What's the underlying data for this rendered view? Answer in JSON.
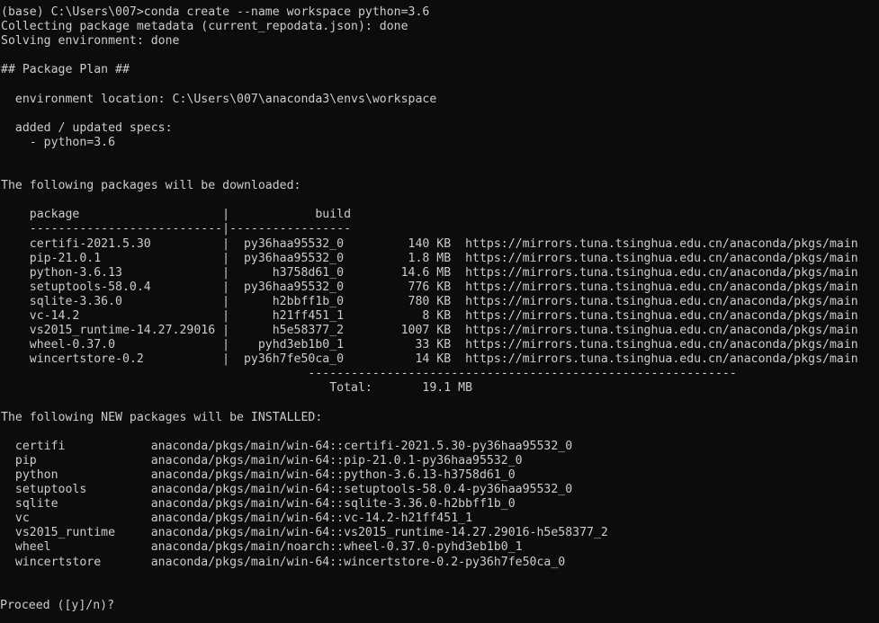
{
  "terminal": {
    "window_kind": "windows-command-prompt",
    "background_color": "#0c0c0c",
    "foreground_color": "#cccccc",
    "columns": 122,
    "rows": 43,
    "prompt_prefix": "(base) C:\\Users\\007>",
    "command": "conda create --name workspace python=3.6",
    "prompt_line": "(base) C:\\Users\\007>conda create --name workspace python=3.6"
  },
  "output": {
    "collecting_metadata": "Collecting package metadata (current_repodata.json): done",
    "solving_environment": "Solving environment: done",
    "package_plan_header": "## Package Plan ##",
    "environment_location_label": "environment location:",
    "environment_location_value": "C:\\Users\\007\\anaconda3\\envs\\workspace",
    "environment_location_line": "  environment location: C:\\Users\\007\\anaconda3\\envs\\workspace",
    "added_updated_specs_label": "added / updated specs:",
    "added_updated_specs_line": "  added / updated specs:",
    "spec_items": [
      "    - python=3.6"
    ],
    "downloaded_header": "The following packages will be downloaded:",
    "installed_header": "The following NEW packages will be INSTALLED:",
    "proceed_prompt": "Proceed ([y]/n)?"
  },
  "download_table": {
    "col_package_header": "package",
    "col_build_header": "build",
    "header_line": "    package                    |            build",
    "separator_line": "    ---------------------------|-----------------",
    "total_separator_line": "                                           ------------------------------------------------------------",
    "total_label": "Total:",
    "total_value": "19.1 MB",
    "total_line": "                                              Total:       19.1 MB",
    "url": "https://mirrors.tuna.tsinghua.edu.cn/anaconda/pkgs/main",
    "rows": [
      {
        "package": "certifi-2021.5.30",
        "build": "py36haa95532_0",
        "size": "140 KB",
        "url": "https://mirrors.tuna.tsinghua.edu.cn/anaconda/pkgs/main",
        "line": "    certifi-2021.5.30          |  py36haa95532_0         140 KB  https://mirrors.tuna.tsinghua.edu.cn/anaconda/pkgs/main"
      },
      {
        "package": "pip-21.0.1",
        "build": "py36haa95532_0",
        "size": "1.8 MB",
        "url": "https://mirrors.tuna.tsinghua.edu.cn/anaconda/pkgs/main",
        "line": "    pip-21.0.1                 |  py36haa95532_0         1.8 MB  https://mirrors.tuna.tsinghua.edu.cn/anaconda/pkgs/main"
      },
      {
        "package": "python-3.6.13",
        "build": "h3758d61_0",
        "size": "14.6 MB",
        "url": "https://mirrors.tuna.tsinghua.edu.cn/anaconda/pkgs/main",
        "line": "    python-3.6.13              |      h3758d61_0        14.6 MB  https://mirrors.tuna.tsinghua.edu.cn/anaconda/pkgs/main"
      },
      {
        "package": "setuptools-58.0.4",
        "build": "py36haa95532_0",
        "size": "776 KB",
        "url": "https://mirrors.tuna.tsinghua.edu.cn/anaconda/pkgs/main",
        "line": "    setuptools-58.0.4          |  py36haa95532_0         776 KB  https://mirrors.tuna.tsinghua.edu.cn/anaconda/pkgs/main"
      },
      {
        "package": "sqlite-3.36.0",
        "build": "h2bbff1b_0",
        "size": "780 KB",
        "url": "https://mirrors.tuna.tsinghua.edu.cn/anaconda/pkgs/main",
        "line": "    sqlite-3.36.0              |      h2bbff1b_0         780 KB  https://mirrors.tuna.tsinghua.edu.cn/anaconda/pkgs/main"
      },
      {
        "package": "vc-14.2",
        "build": "h21ff451_1",
        "size": "8 KB",
        "url": "https://mirrors.tuna.tsinghua.edu.cn/anaconda/pkgs/main",
        "line": "    vc-14.2                    |      h21ff451_1           8 KB  https://mirrors.tuna.tsinghua.edu.cn/anaconda/pkgs/main"
      },
      {
        "package": "vs2015_runtime-14.27.29016",
        "build": "h5e58377_2",
        "size": "1007 KB",
        "url": "https://mirrors.tuna.tsinghua.edu.cn/anaconda/pkgs/main",
        "line": "    vs2015_runtime-14.27.29016 |      h5e58377_2        1007 KB  https://mirrors.tuna.tsinghua.edu.cn/anaconda/pkgs/main"
      },
      {
        "package": "wheel-0.37.0",
        "build": "pyhd3eb1b0_1",
        "size": "33 KB",
        "url": "https://mirrors.tuna.tsinghua.edu.cn/anaconda/pkgs/main",
        "line": "    wheel-0.37.0               |    pyhd3eb1b0_1          33 KB  https://mirrors.tuna.tsinghua.edu.cn/anaconda/pkgs/main"
      },
      {
        "package": "wincertstore-0.2",
        "build": "py36h7fe50ca_0",
        "size": "14 KB",
        "url": "https://mirrors.tuna.tsinghua.edu.cn/anaconda/pkgs/main",
        "line": "    wincertstore-0.2           |  py36h7fe50ca_0          14 KB  https://mirrors.tuna.tsinghua.edu.cn/anaconda/pkgs/main"
      }
    ]
  },
  "install_table": {
    "rows": [
      {
        "name": "certifi",
        "spec": "anaconda/pkgs/main/win-64::certifi-2021.5.30-py36haa95532_0",
        "line": "  certifi            anaconda/pkgs/main/win-64::certifi-2021.5.30-py36haa95532_0"
      },
      {
        "name": "pip",
        "spec": "anaconda/pkgs/main/win-64::pip-21.0.1-py36haa95532_0",
        "line": "  pip                anaconda/pkgs/main/win-64::pip-21.0.1-py36haa95532_0"
      },
      {
        "name": "python",
        "spec": "anaconda/pkgs/main/win-64::python-3.6.13-h3758d61_0",
        "line": "  python             anaconda/pkgs/main/win-64::python-3.6.13-h3758d61_0"
      },
      {
        "name": "setuptools",
        "spec": "anaconda/pkgs/main/win-64::setuptools-58.0.4-py36haa95532_0",
        "line": "  setuptools         anaconda/pkgs/main/win-64::setuptools-58.0.4-py36haa95532_0"
      },
      {
        "name": "sqlite",
        "spec": "anaconda/pkgs/main/win-64::sqlite-3.36.0-h2bbff1b_0",
        "line": "  sqlite             anaconda/pkgs/main/win-64::sqlite-3.36.0-h2bbff1b_0"
      },
      {
        "name": "vc",
        "spec": "anaconda/pkgs/main/win-64::vc-14.2-h21ff451_1",
        "line": "  vc                 anaconda/pkgs/main/win-64::vc-14.2-h21ff451_1"
      },
      {
        "name": "vs2015_runtime",
        "spec": "anaconda/pkgs/main/win-64::vs2015_runtime-14.27.29016-h5e58377_2",
        "line": "  vs2015_runtime     anaconda/pkgs/main/win-64::vs2015_runtime-14.27.29016-h5e58377_2"
      },
      {
        "name": "wheel",
        "spec": "anaconda/pkgs/main/noarch::wheel-0.37.0-pyhd3eb1b0_1",
        "line": "  wheel              anaconda/pkgs/main/noarch::wheel-0.37.0-pyhd3eb1b0_1"
      },
      {
        "name": "wincertstore",
        "spec": "anaconda/pkgs/main/win-64::wincertstore-0.2-py36h7fe50ca_0",
        "line": "  wincertstore       anaconda/pkgs/main/win-64::wincertstore-0.2-py36h7fe50ca_0"
      }
    ]
  }
}
